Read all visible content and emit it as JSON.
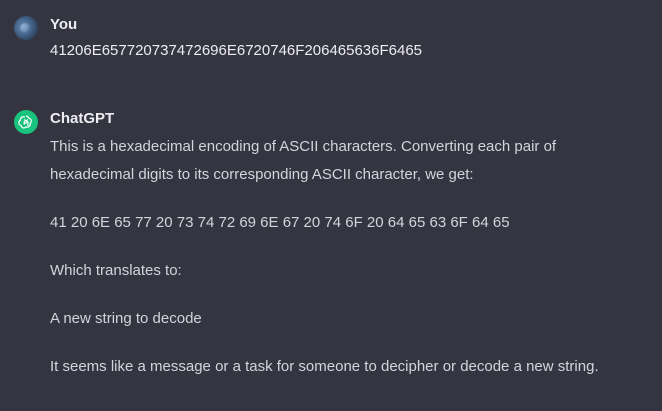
{
  "conversation": {
    "user": {
      "author": "You",
      "text": "41206E657720737472696E6720746F206465636F6465",
      "avatar_icon": "globe-avatar-icon"
    },
    "assistant": {
      "author": "ChatGPT",
      "avatar_icon": "openai-logo-icon",
      "avatar_color": "#19c37d",
      "lines": [
        "This is a hexadecimal encoding of ASCII characters. Converting each pair of",
        "hexadecimal digits to its corresponding ASCII character, we get:",
        "41 20 6E 65 77 20 73 74 72 69 6E 67 20 74 6F 20 64 65 63 6F 64 65",
        "Which translates to:",
        "A new string to decode",
        "It seems like a message or a task for someone to decipher or decode a new string."
      ]
    }
  },
  "colors": {
    "background": "#343541",
    "text": "#ececf1",
    "muted_text": "#d1d5db"
  }
}
